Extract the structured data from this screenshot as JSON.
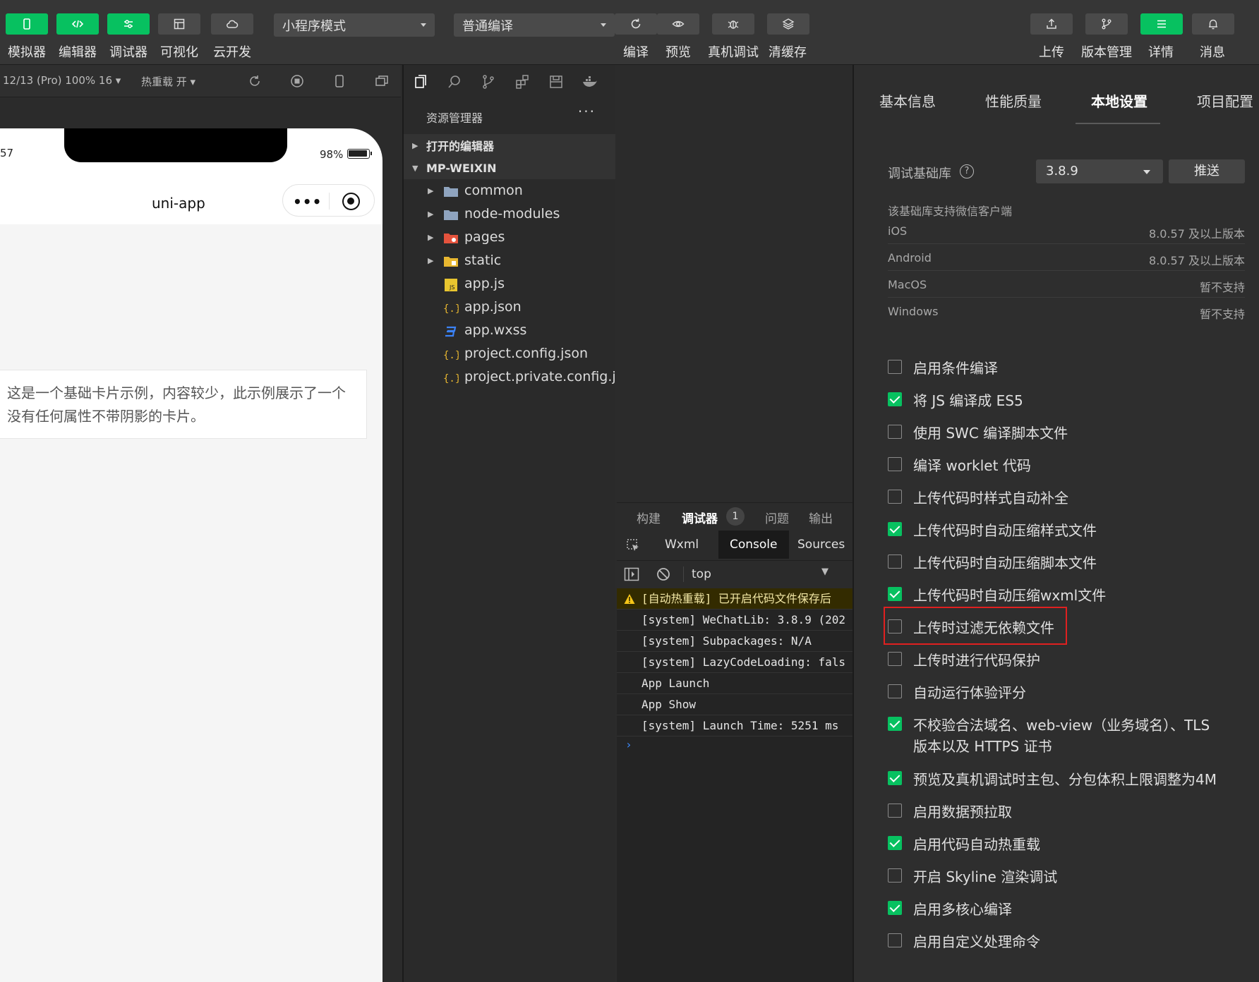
{
  "toolbar": {
    "buttons": [
      {
        "label": "模拟器",
        "icon": "phone-icon"
      },
      {
        "label": "编辑器",
        "icon": "code-icon"
      },
      {
        "label": "调试器",
        "icon": "debug-icon"
      },
      {
        "label": "可视化",
        "icon": "layout-icon"
      },
      {
        "label": "云开发",
        "icon": "cloud-icon"
      }
    ],
    "mode_select": "小程序模式",
    "compile_select": "普通编译",
    "actions": [
      {
        "label": "编译",
        "icon": "refresh-icon"
      },
      {
        "label": "预览",
        "icon": "eye-icon"
      },
      {
        "label": "真机调试",
        "icon": "bug-icon"
      },
      {
        "label": "清缓存",
        "icon": "layers-icon"
      }
    ],
    "right": [
      {
        "label": "上传",
        "icon": "upload-icon"
      },
      {
        "label": "版本管理",
        "icon": "branch-icon"
      },
      {
        "label": "详情",
        "icon": "menu-icon"
      },
      {
        "label": "消息",
        "icon": "bell-icon"
      }
    ],
    "accent": "#07c160"
  },
  "simulator": {
    "device_info": "12/13 (Pro) 100% 16 ▾",
    "hot_reload": "热重载 开 ▾",
    "status_time": "57",
    "battery": "98%",
    "nav_title": "uni-app",
    "capsule_dots": "•••",
    "card_text": "这是一个基础卡片示例，内容较少，此示例展示了一个没有任何属性不带阴影的卡片。"
  },
  "explorer": {
    "title": "资源管理器",
    "more": "···",
    "sections": [
      {
        "label": "打开的编辑器"
      },
      {
        "label": "MP-WEIXIN"
      }
    ],
    "items": [
      {
        "name": "common",
        "type": "folder"
      },
      {
        "name": "node-modules",
        "type": "folder"
      },
      {
        "name": "pages",
        "type": "folder-pages"
      },
      {
        "name": "static",
        "type": "folder-static"
      },
      {
        "name": "app.js",
        "type": "js"
      },
      {
        "name": "app.json",
        "type": "json"
      },
      {
        "name": "app.wxss",
        "type": "css"
      },
      {
        "name": "project.config.json",
        "type": "json"
      },
      {
        "name": "project.private.config.js...",
        "type": "json"
      }
    ]
  },
  "console": {
    "tabs": [
      "构建",
      "调试器",
      "问题",
      "输出"
    ],
    "badge": "1",
    "devtabs": [
      "Wxml",
      "Console",
      "Sources"
    ],
    "context": "top",
    "lines": [
      {
        "text": "[自动热重载] 已开启代码文件保存后",
        "warn": true
      },
      {
        "text": "[system] WeChatLib: 3.8.9 (202",
        "warn": false
      },
      {
        "text": "[system] Subpackages: N/A",
        "warn": false
      },
      {
        "text": "[system] LazyCodeLoading: fals",
        "warn": false
      },
      {
        "text": "App Launch",
        "warn": false
      },
      {
        "text": "App Show",
        "warn": false
      },
      {
        "text": "[system] Launch Time: 5251 ms",
        "warn": false
      }
    ],
    "prompt": "›"
  },
  "details": {
    "tabs": [
      "基本信息",
      "性能质量",
      "本地设置",
      "项目配置"
    ],
    "active_tab": "本地设置",
    "lib_label": "调试基础库",
    "help": "?",
    "lib_version": "3.8.9",
    "push_label": "推送",
    "support_title": "该基础库支持微信客户端",
    "support": [
      {
        "platform": "iOS",
        "value": "8.0.57 及以上版本"
      },
      {
        "platform": "Android",
        "value": "8.0.57 及以上版本"
      },
      {
        "platform": "MacOS",
        "value": "暂不支持"
      },
      {
        "platform": "Windows",
        "value": "暂不支持"
      }
    ],
    "options": [
      {
        "label": "启用条件编译",
        "checked": false
      },
      {
        "label": "将 JS 编译成 ES5",
        "checked": true
      },
      {
        "label": "使用 SWC 编译脚本文件",
        "checked": false
      },
      {
        "label": "编译 worklet 代码",
        "checked": false
      },
      {
        "label": "上传代码时样式自动补全",
        "checked": false
      },
      {
        "label": "上传代码时自动压缩样式文件",
        "checked": true
      },
      {
        "label": "上传代码时自动压缩脚本文件",
        "checked": false
      },
      {
        "label": "上传代码时自动压缩wxml文件",
        "checked": true
      },
      {
        "label": "上传时过滤无依赖文件",
        "checked": false
      },
      {
        "label": "上传时进行代码保护",
        "checked": false
      },
      {
        "label": "自动运行体验评分",
        "checked": false
      },
      {
        "label": "不校验合法域名、web-view（业务域名）、TLS 版本以及 HTTPS 证书",
        "checked": true
      },
      {
        "label": "预览及真机调试时主包、分包体积上限调整为4M",
        "checked": true
      },
      {
        "label": "启用数据预拉取",
        "checked": false
      },
      {
        "label": "启用代码自动热重载",
        "checked": true
      },
      {
        "label": "开启 Skyline 渲染调试",
        "checked": false
      },
      {
        "label": "启用多核心编译",
        "checked": true
      },
      {
        "label": "启用自定义处理命令",
        "checked": false
      }
    ],
    "highlight_color": "#e02020"
  }
}
